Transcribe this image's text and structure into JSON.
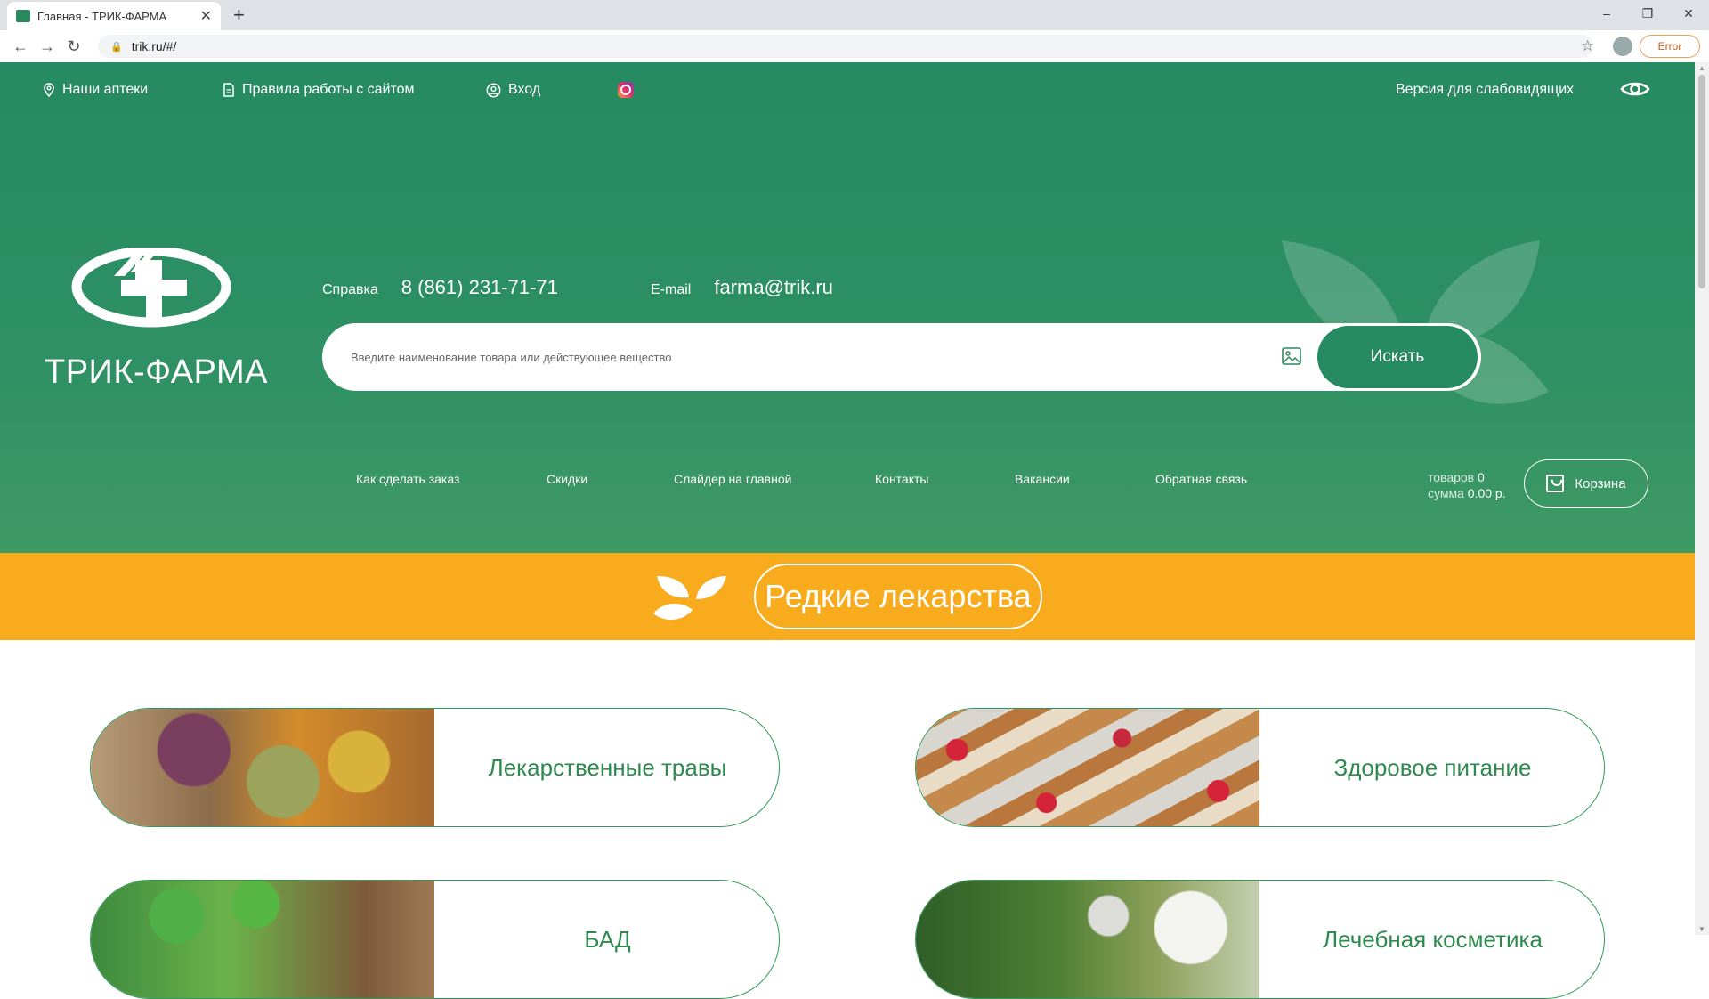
{
  "browser": {
    "tab_title": "Главная - ТРИК-ФАРМА",
    "tab_close": "✕",
    "new_tab": "+",
    "url": "trik.ru/#/",
    "error_label": "Error"
  },
  "topnav": {
    "pharmacies": "Наши аптеки",
    "rules": "Правила работы с сайтом",
    "login": "Вход",
    "low_vision": "Версия для слабовидящих"
  },
  "brand": {
    "name": "ТРИК-ФАРМА"
  },
  "contacts": {
    "help_label": "Справка",
    "phone": "8 (861) 231-71-71",
    "email_label": "E-mail",
    "email": "farma@trik.ru"
  },
  "search": {
    "placeholder": "Введите наименование товара или действующее вещество",
    "button": "Искать"
  },
  "mainnav": {
    "items": [
      "Как сделать заказ",
      "Скидки",
      "Слайдер на главной",
      "Контакты",
      "Вакансии",
      "Обратная связь"
    ]
  },
  "cart": {
    "items_label": "товаров",
    "items_count": "0",
    "sum_label": "сумма",
    "sum_value": "0.00 р.",
    "button": "Корзина"
  },
  "banner": {
    "rare_drugs": "Редкие лекарства"
  },
  "categories": [
    {
      "label": "Лекарственные травы"
    },
    {
      "label": "Здоровое питание"
    },
    {
      "label": "БАД"
    },
    {
      "label": "Лечебная косметика"
    }
  ],
  "colors": {
    "brand_green": "#268a62",
    "accent_orange": "#f8ab1d",
    "card_text": "#2e8a4f"
  }
}
